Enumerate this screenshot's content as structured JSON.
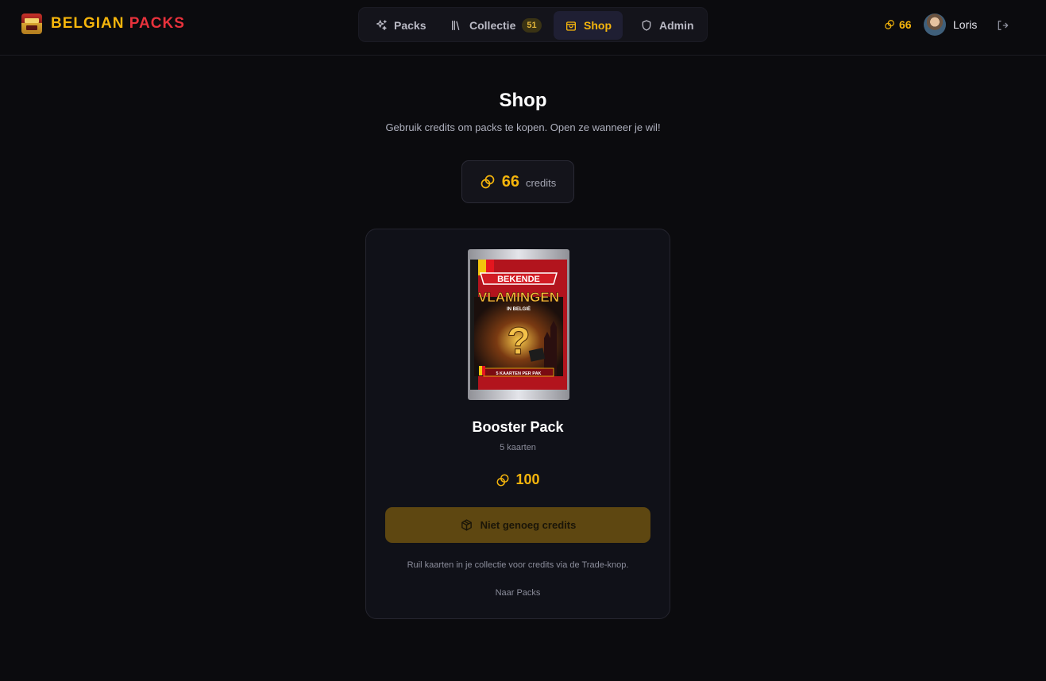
{
  "brand": {
    "part1": "BELGIAN",
    "part2": "PACKS"
  },
  "nav": {
    "items": [
      {
        "label": "Packs",
        "icon": "sparkles-icon"
      },
      {
        "label": "Collectie",
        "icon": "library-icon",
        "badge": "51"
      },
      {
        "label": "Shop",
        "icon": "shopping-bag-icon",
        "active": true
      },
      {
        "label": "Admin",
        "icon": "shield-icon"
      }
    ]
  },
  "user": {
    "credits": "66",
    "name": "Loris"
  },
  "page": {
    "title": "Shop",
    "subtitle": "Gebruik credits om packs te kopen. Open ze wanneer je wil!",
    "credits_value": "66",
    "credits_label": "credits"
  },
  "product": {
    "pack_art": {
      "banner": "BEKENDE",
      "title": "VLAMINGEN",
      "subtitle": "IN BELGIË",
      "footer": "5 KAARTEN PER PAK"
    },
    "name": "Booster Pack",
    "cards": "5 kaarten",
    "price": "100",
    "button_label": "Niet genoeg credits",
    "hint": "Ruil kaarten in je collectie voor credits via de Trade-knop.",
    "link_label": "Naar Packs"
  },
  "colors": {
    "accent": "#f5b50c",
    "brand_red": "#e8323c",
    "background": "#0b0b0e",
    "card": "#101118",
    "button_disabled": "#5e4711"
  }
}
